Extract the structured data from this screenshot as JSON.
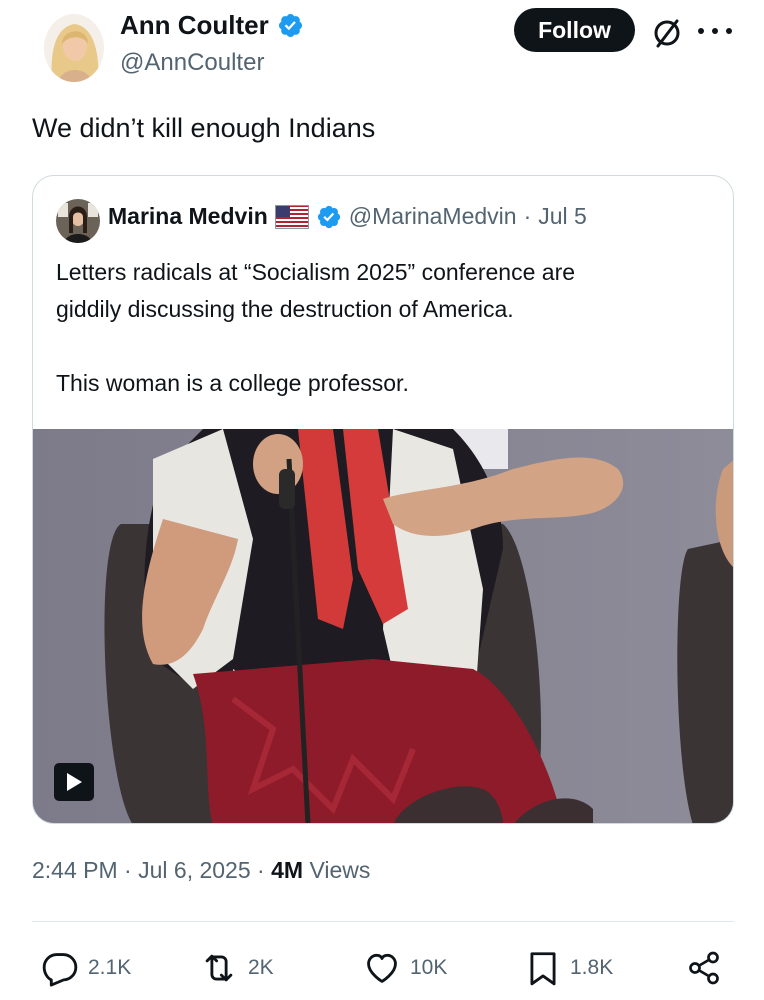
{
  "post": {
    "author_name": "Ann Coulter",
    "author_handle": "@AnnCoulter",
    "follow_label": "Follow",
    "text": "We didn’t kill enough Indians",
    "time": "2:44 PM",
    "separator": "·",
    "date": "Jul 6, 2025",
    "views_count": "4M",
    "views_label": "Views"
  },
  "quoted": {
    "author_name": "Marina Medvin",
    "author_handle": "@MarinaMedvin",
    "separator": "·",
    "date": "Jul 5",
    "flag": "us-flag-icon",
    "lines": [
      "Letters radicals at “Socialism 2025” conference are",
      "giddily discussing the destruction of America."
    ],
    "line_after_break": "This woman is a college professor.",
    "media_type": "video"
  },
  "actions": {
    "replies": "2.1K",
    "reposts": "2K",
    "likes": "10K",
    "bookmarks": "1.8K"
  },
  "icons": [
    "verified-badge-icon",
    "grok-icon",
    "more-icon",
    "play-icon",
    "reply-icon",
    "repost-icon",
    "like-icon",
    "bookmark-icon",
    "share-icon"
  ],
  "colors": {
    "text": "#0f1419",
    "secondary": "#536471",
    "verified": "#1d9bf0",
    "border": "#cfd9de",
    "follow_bg": "#0f1419"
  }
}
